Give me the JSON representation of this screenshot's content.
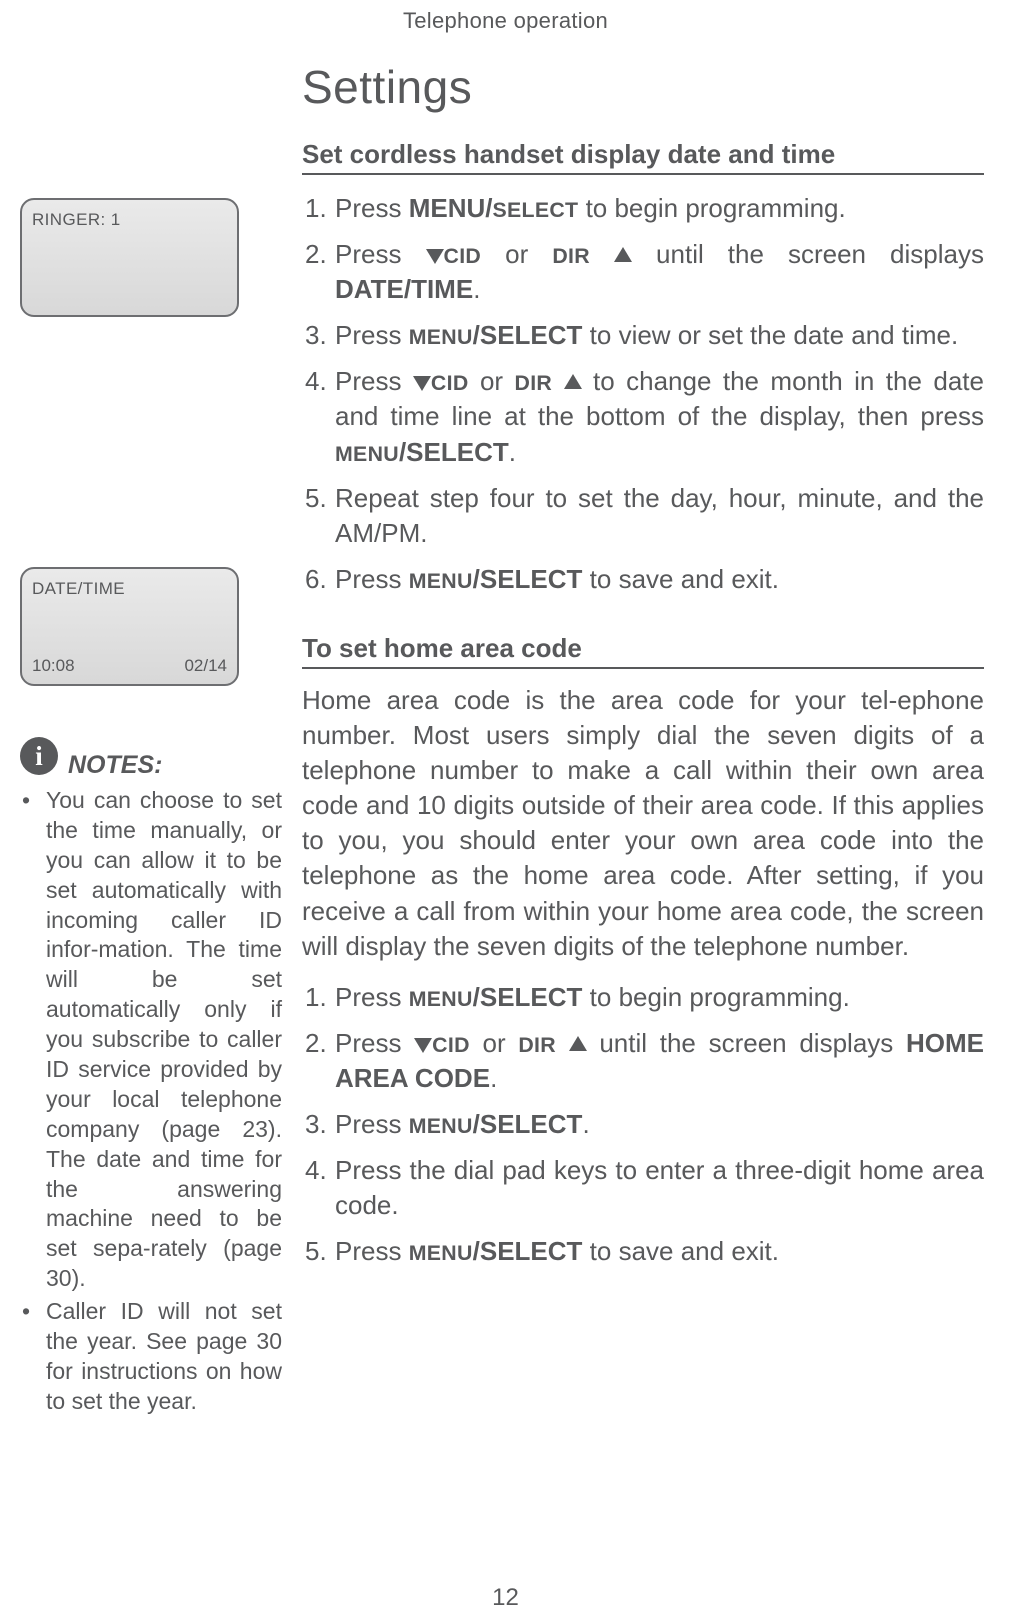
{
  "header": "Telephone operation",
  "page_number": "12",
  "main": {
    "title": "Settings",
    "section1": {
      "heading": "Set cordless handset display date and time",
      "steps": {
        "s1_a": "Press ",
        "s1_b": "MENU/",
        "s1_c": "SELECT",
        "s1_d": " to begin programming.",
        "s2_a": "Press ",
        "s2_cid": "CID",
        "s2_or": "  or ",
        "s2_dir": "DIR",
        "s2_b": " until the screen displays ",
        "s2_c": "DATE/TIME",
        "s2_d": ".",
        "s3_a": "Press ",
        "s3_b": "MENU",
        "s3_c": "/SELECT",
        "s3_d": " to view or set the date and time.",
        "s4_a": "Press ",
        "s4_cid": "CID",
        "s4_or": " or ",
        "s4_dir": "DIR",
        "s4_b": " to change the month in the date and time line at the bottom of the display, then press ",
        "s4_c": "MENU",
        "s4_d": "/SELECT",
        "s4_e": ".",
        "s5": "Repeat step four to set the day, hour, minute, and the AM/PM.",
        "s6_a": "Press ",
        "s6_b": "MENU",
        "s6_c": "/SELECT",
        "s6_d": "  to save and exit."
      }
    },
    "section2": {
      "heading": "To set home area code",
      "intro": "Home area code is the area code for your tel-ephone number. Most users simply dial the seven digits of a telephone number to make a call within their own area code and 10 digits outside of their area code. If this applies to you, you should enter your own area code into the telephone as the home area code. After setting, if you receive a call from within your home area code, the screen will display the seven digits of the telephone number.",
      "steps": {
        "s1_a": "Press ",
        "s1_b": "MENU",
        "s1_c": "/SELECT",
        "s1_d": " to begin programming.",
        "s2_a": "Press ",
        "s2_cid": "CID",
        "s2_or": "  or ",
        "s2_dir": "DIR",
        "s2_b": " until the screen displays ",
        "s2_c": "HOME AREA CODE",
        "s2_d": ".",
        "s3_a": "Press ",
        "s3_b": "MENU",
        "s3_c": "/SELECT",
        "s3_d": ".",
        "s4": "Press the dial pad keys to enter a three-digit home area code.",
        "s5_a": "Press ",
        "s5_b": "MENU",
        "s5_c": "/SELECT",
        "s5_d": " to save and exit."
      }
    }
  },
  "sidebar": {
    "screen1": {
      "line1": "RINGER: 1"
    },
    "screen2": {
      "line1": "DATE/TIME",
      "bottom_left": "10:08",
      "bottom_right": "02/14"
    },
    "notes_label": "NOTES:",
    "notes": {
      "n1": "You can choose to set the time manually, or you can allow it to be set automatically with incoming caller ID infor-mation. The time will be set automatically only if you subscribe to caller ID service provided by your local telephone company (page 23). The date and time for the answering machine need to be set sepa-rately (page 30).",
      "n2": "Caller ID will not set the year. See page 30 for instructions on how to set the year."
    }
  }
}
